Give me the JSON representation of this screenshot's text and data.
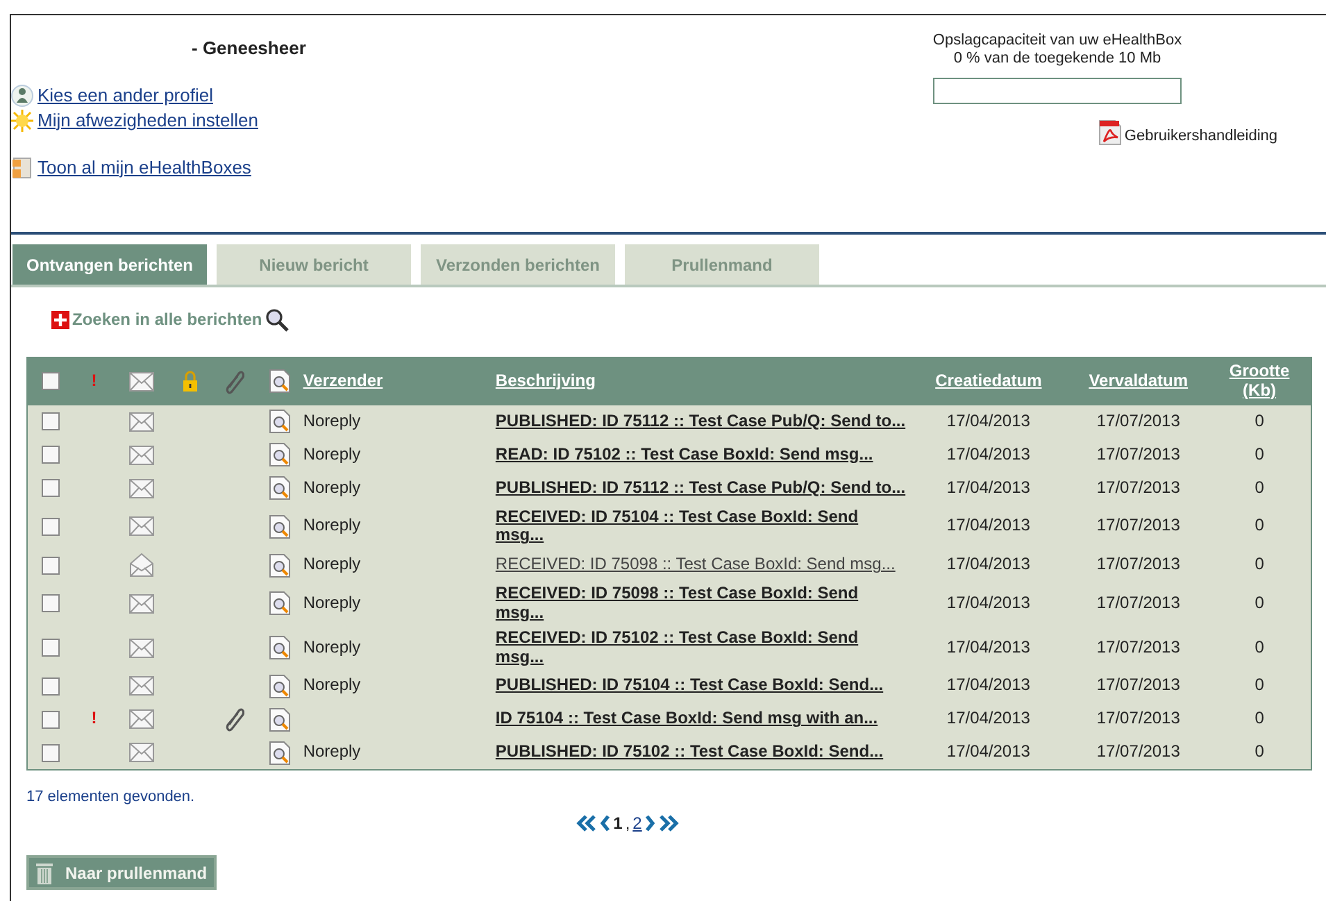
{
  "header": {
    "role": "- Geneesheer",
    "links": [
      {
        "kind": "profile",
        "label": "Kies een ander profiel"
      },
      {
        "kind": "absence",
        "label": "Mijn afwezigheden instellen"
      },
      {
        "kind": "boxes",
        "label": "Toon al mijn eHealthBoxes"
      }
    ],
    "storage": {
      "title": "Opslagcapaciteit van uw eHealthBox",
      "reading": "0 % van de toegekende 10 Mb",
      "level": 0
    },
    "manual": "Gebruikershandleiding"
  },
  "tabs": [
    {
      "label": "Ontvangen berichten",
      "selected": true
    },
    {
      "label": "Nieuw bericht",
      "selected": false
    },
    {
      "label": "Verzonden berichten",
      "selected": false
    },
    {
      "label": "Prullenmand",
      "selected": false
    }
  ],
  "search_link": "Zoeken in alle berichten",
  "table": {
    "select_all": {
      "checked": false
    },
    "columns": [
      {
        "kind": "checkbox"
      },
      {
        "kind": "urgent",
        "label": "!"
      },
      {
        "kind": "envelope"
      },
      {
        "kind": "lock"
      },
      {
        "kind": "attachment"
      },
      {
        "kind": "preview"
      },
      {
        "kind": "text",
        "label": "Verzender"
      },
      {
        "kind": "text",
        "label": "Beschrijving"
      },
      {
        "kind": "text",
        "label": "Creatiedatum"
      },
      {
        "kind": "text",
        "label": "Vervaldatum"
      },
      {
        "kind": "text",
        "label": "Grootte (Kb)"
      }
    ],
    "rows": [
      {
        "checked": false,
        "urgent": false,
        "read": false,
        "attachment": false,
        "sender": "Noreply",
        "description": "PUBLISHED: ID 75112 :: Test Case Pub/Q: Send to...",
        "created": "17/04/2013",
        "expires": "17/07/2013",
        "size": "0"
      },
      {
        "checked": false,
        "urgent": false,
        "read": false,
        "attachment": false,
        "sender": "Noreply",
        "description": "READ: ID 75102 :: Test Case BoxId: Send msg...",
        "created": "17/04/2013",
        "expires": "17/07/2013",
        "size": "0"
      },
      {
        "checked": false,
        "urgent": false,
        "read": false,
        "attachment": false,
        "sender": "Noreply",
        "description": "PUBLISHED: ID 75112 :: Test Case Pub/Q: Send to...",
        "created": "17/04/2013",
        "expires": "17/07/2013",
        "size": "0"
      },
      {
        "checked": false,
        "urgent": false,
        "read": false,
        "attachment": false,
        "sender": "Noreply",
        "description": "RECEIVED: ID 75104 :: Test Case BoxId: Send msg...",
        "created": "17/04/2013",
        "expires": "17/07/2013",
        "size": "0"
      },
      {
        "checked": false,
        "urgent": false,
        "read": true,
        "attachment": false,
        "sender": "Noreply",
        "description": "RECEIVED: ID 75098 :: Test Case BoxId: Send msg...",
        "created": "17/04/2013",
        "expires": "17/07/2013",
        "size": "0"
      },
      {
        "checked": false,
        "urgent": false,
        "read": false,
        "attachment": false,
        "sender": "Noreply",
        "description": "RECEIVED: ID 75098 :: Test Case BoxId: Send msg...",
        "created": "17/04/2013",
        "expires": "17/07/2013",
        "size": "0"
      },
      {
        "checked": false,
        "urgent": false,
        "read": false,
        "attachment": false,
        "sender": "Noreply",
        "description": "RECEIVED: ID 75102 :: Test Case BoxId: Send msg...",
        "created": "17/04/2013",
        "expires": "17/07/2013",
        "size": "0"
      },
      {
        "checked": false,
        "urgent": false,
        "read": false,
        "attachment": false,
        "sender": "Noreply",
        "description": "PUBLISHED: ID 75104 :: Test Case BoxId: Send...",
        "created": "17/04/2013",
        "expires": "17/07/2013",
        "size": "0"
      },
      {
        "checked": false,
        "urgent": true,
        "read": false,
        "attachment": true,
        "description": "ID 75104 :: Test Case BoxId: Send msg with an...",
        "created": "17/04/2013",
        "expires": "17/07/2013",
        "size": "0"
      },
      {
        "checked": false,
        "urgent": false,
        "read": false,
        "attachment": false,
        "sender": "Noreply",
        "description": "PUBLISHED: ID 75102 :: Test Case BoxId: Send...",
        "created": "17/04/2013",
        "expires": "17/07/2013",
        "size": "0"
      }
    ]
  },
  "count": "17 elementen gevonden.",
  "pager": {
    "pages": [
      {
        "label": "1",
        "selected": true
      },
      {
        "label": "2",
        "selected": false
      }
    ],
    "separator": ","
  },
  "trash_button": "Naar prullenmand"
}
